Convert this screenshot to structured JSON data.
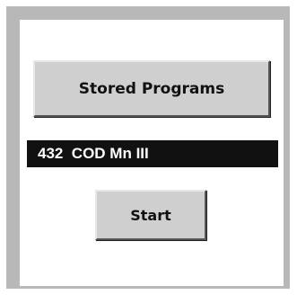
{
  "stored_programs_button": {
    "label": "Stored Programs"
  },
  "program_display": {
    "text": "432  COD Mn III"
  },
  "start_button": {
    "label": "Start"
  }
}
